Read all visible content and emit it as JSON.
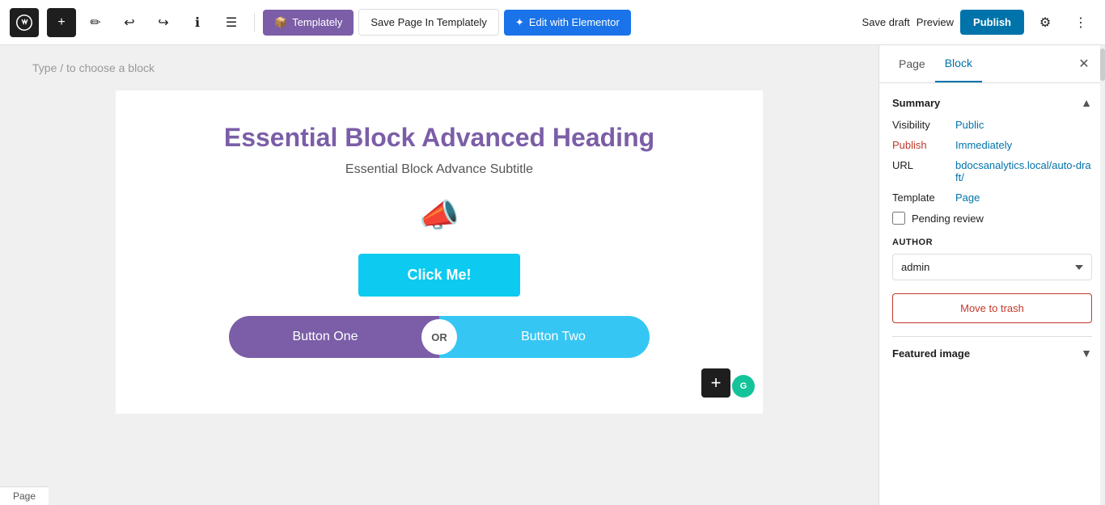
{
  "toolbar": {
    "add_label": "+",
    "templately_label": "Templately",
    "save_page_label": "Save Page In Templately",
    "elementor_label": "Edit with Elementor",
    "save_draft_label": "Save draft",
    "preview_label": "Preview",
    "publish_label": "Publish"
  },
  "editor": {
    "block_hint": "Type / to choose a block",
    "heading": "Essential Block Advanced Heading",
    "subtitle": "Essential Block Advance Subtitle",
    "click_me_label": "Click Me!",
    "button_one_label": "Button One",
    "or_label": "OR",
    "button_two_label": "Button Two"
  },
  "panel": {
    "page_tab": "Page",
    "block_tab": "Block",
    "summary_title": "Summary",
    "visibility_label": "Visibility",
    "visibility_value": "Public",
    "publish_label": "Publish",
    "publish_value": "Immediately",
    "url_label": "URL",
    "url_value": "bdocsanalytics.local/auto-draft/",
    "template_label": "Template",
    "template_value": "Page",
    "pending_review_label": "Pending review",
    "author_label": "AUTHOR",
    "author_value": "admin",
    "move_to_trash_label": "Move to trash",
    "featured_image_label": "Featured image"
  },
  "status_bar": {
    "label": "Page"
  }
}
